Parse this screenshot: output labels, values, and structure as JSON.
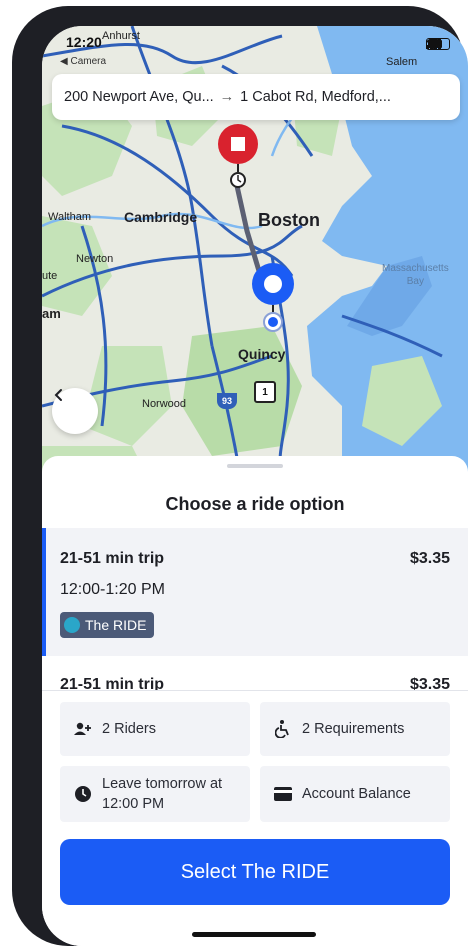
{
  "status_bar": {
    "time": "12:20",
    "back_app": "◀ Camera"
  },
  "route": {
    "origin": "200 Newport Ave, Qu...",
    "destination": "1 Cabot Rd, Medford,...",
    "arrow": "→"
  },
  "map": {
    "labels": {
      "anhurst": "Anhurst",
      "salem": "Salem",
      "waltham": "Waltham",
      "cambridge": "Cambridge",
      "boston": "Boston",
      "newton": "Newton",
      "massachusetts_bay": "Massachusetts\nBay",
      "quincy": "Quincy",
      "norwood": "Norwood",
      "am": "am",
      "ute": "ute"
    },
    "highway_shields": [
      "93",
      "1"
    ]
  },
  "sheet": {
    "title": "Choose a ride option",
    "options": [
      {
        "duration": "21-51 min trip",
        "price": "$3.35",
        "window": "12:00-1:20 PM",
        "service": "The RIDE"
      },
      {
        "duration": "21-51 min trip",
        "price": "$3.35"
      }
    ],
    "details": {
      "riders": "2 Riders",
      "requirements": "2 Requirements",
      "leave": "Leave tomorrow at 12:00 PM",
      "payment": "Account Balance"
    },
    "cta": "Select The RIDE"
  },
  "colors": {
    "accent": "#1b5cf5",
    "destination_pin": "#d9222e",
    "badge": "#4c5a78"
  }
}
